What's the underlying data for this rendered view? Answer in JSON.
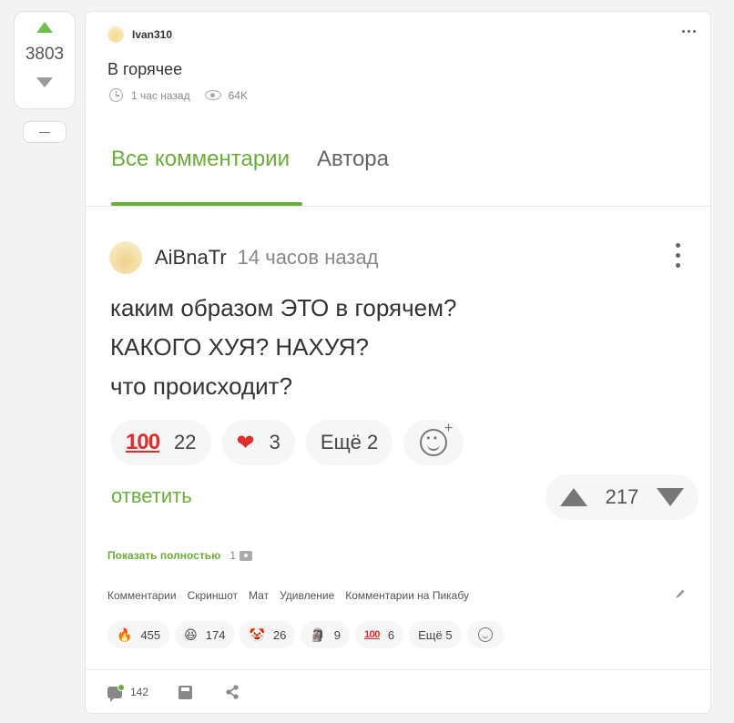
{
  "post": {
    "rating": "3803",
    "author": "Ivan310",
    "title": "В горячее",
    "time_ago": "1 час назад",
    "views": "64K"
  },
  "tabs": [
    {
      "label": "Все комментарии",
      "active": true
    },
    {
      "label": "Автора",
      "active": false
    }
  ],
  "comment": {
    "author": "AiBnaTr",
    "time_ago": "14 часов назад",
    "lines": [
      "каким образом ЭТО в горячем?",
      "КАКОГО ХУЯ? НАХУЯ?",
      "что происходит?"
    ],
    "reactions": [
      {
        "icon": "hundred-points-icon",
        "glyph": "100",
        "count": "22"
      },
      {
        "icon": "red-heart-icon",
        "glyph": "❤",
        "count": "3"
      }
    ],
    "more_reactions": "Ещё 2",
    "reply_label": "ответить",
    "score": "217"
  },
  "show_full": {
    "label": "Показать полностью",
    "count": "1"
  },
  "tags": [
    "Комментарии",
    "Скриншот",
    "Мат",
    "Удивление",
    "Комментарии на Пикабу"
  ],
  "post_reactions": [
    {
      "icon": "fire-icon",
      "glyph": "🔥",
      "count": "455"
    },
    {
      "icon": "laughing-face-icon",
      "glyph": "😆",
      "count": "174"
    },
    {
      "icon": "clown-face-icon",
      "glyph": "🤡",
      "count": "26"
    },
    {
      "icon": "moai-icon",
      "glyph": "🗿",
      "count": "9"
    },
    {
      "icon": "hundred-points-icon",
      "glyph": "100",
      "count": "6"
    }
  ],
  "post_more_reactions": "Ещё 5",
  "footer": {
    "comments_count": "142"
  },
  "colors": {
    "accent": "#6aad3a",
    "rating_up": "#6fbf4c"
  }
}
